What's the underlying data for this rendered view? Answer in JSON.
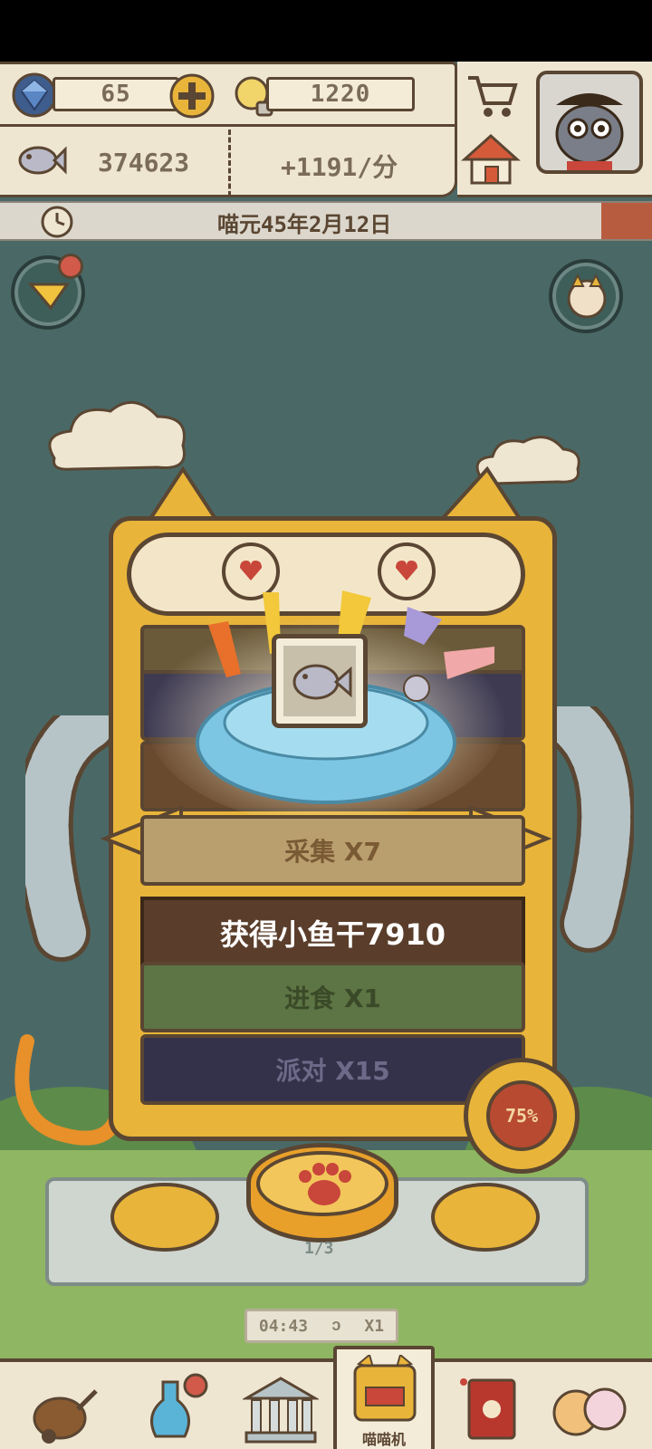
{
  "resources": {
    "gems": "65",
    "bulbs": "1220",
    "fish": "374623",
    "rate": "+1191/分"
  },
  "date_bar": {
    "date": "喵元45年2月12日"
  },
  "tasks": [
    {
      "label": "采集 X7"
    },
    {
      "label": "进食 X1"
    },
    {
      "label": "派对 X15"
    }
  ],
  "toast": {
    "message": "获得小鱼干7910"
  },
  "progress": {
    "label": "75%",
    "value": 0.75
  },
  "paw_button": {
    "count": "1/3"
  },
  "timer": {
    "time": "04:43",
    "multiplier": "X1"
  },
  "bottom_nav": {
    "items": [
      {
        "icon": "cart-icon"
      },
      {
        "icon": "potion-icon"
      },
      {
        "icon": "temple-icon"
      },
      {
        "icon": "machine-icon",
        "label": "喵喵机"
      },
      {
        "icon": "book-icon"
      },
      {
        "icon": "cats-icon"
      }
    ]
  },
  "colors": {
    "accent": "#e8b43a",
    "outline": "#5a4632",
    "background": "#4a6966"
  }
}
